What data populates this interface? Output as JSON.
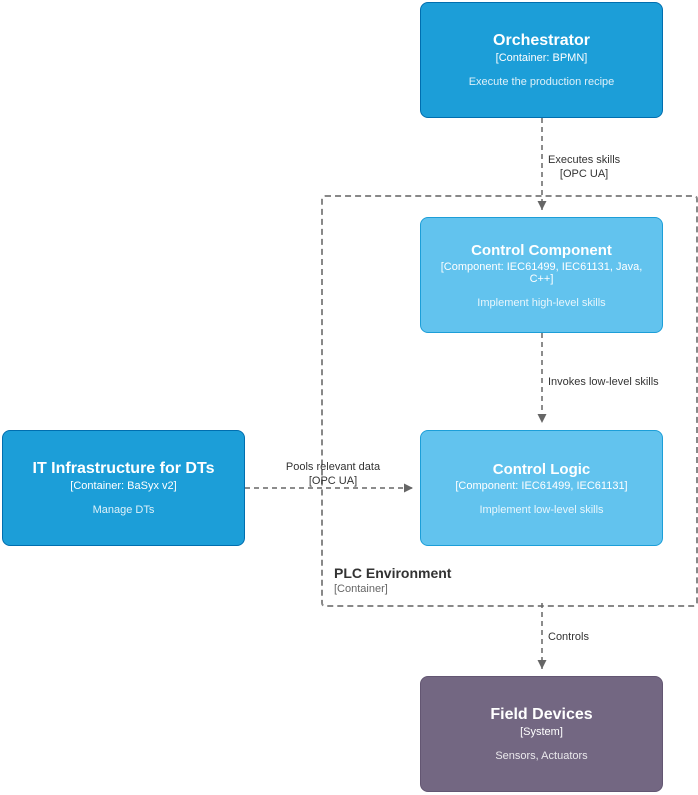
{
  "nodes": {
    "orchestrator": {
      "title": "Orchestrator",
      "subtitle": "[Container: BPMN]",
      "desc": "Execute the production recipe"
    },
    "control_component": {
      "title": "Control Component",
      "subtitle": "[Component: IEC61499, IEC61131, Java, C++]",
      "desc": "Implement high-level skills"
    },
    "control_logic": {
      "title": "Control Logic",
      "subtitle": "[Component: IEC61499, IEC61131]",
      "desc": "Implement low-level skills"
    },
    "it_infra": {
      "title": "IT Infrastructure for DTs",
      "subtitle": "[Container: BaSyx v2]",
      "desc": "Manage DTs"
    },
    "field_devices": {
      "title": "Field Devices",
      "subtitle": "[System]",
      "desc": "Sensors, Actuators"
    }
  },
  "group": {
    "title": "PLC Environment",
    "subtitle": "[Container]"
  },
  "edges": {
    "exec_skills": {
      "label": "Executes skills",
      "sub": "[OPC UA]"
    },
    "invokes": {
      "label": "Invokes low-level skills"
    },
    "pools": {
      "label": "Pools relevant data",
      "sub": "[OPC UA]"
    },
    "controls": {
      "label": "Controls"
    }
  }
}
